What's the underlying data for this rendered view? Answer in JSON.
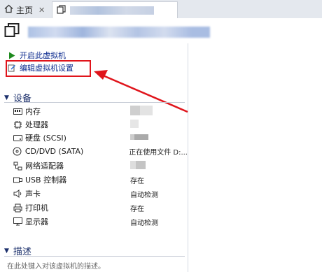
{
  "tabs": [
    {
      "label": "主页",
      "icon": "home-icon"
    },
    {
      "label": "",
      "icon": "vm-icon"
    }
  ],
  "actions": {
    "power_on": "开启此虚拟机",
    "edit_settings": "编辑虚拟机设置"
  },
  "devices_section": {
    "title": "设备",
    "rows": [
      {
        "icon": "memory-icon",
        "name": "内存",
        "value": ""
      },
      {
        "icon": "processor-icon",
        "name": "处理器",
        "value": ""
      },
      {
        "icon": "disk-icon",
        "name": "硬盘 (SCSI)",
        "value": ""
      },
      {
        "icon": "cd-dvd-icon",
        "name": "CD/DVD (SATA)",
        "value": "正在使用文件 D:..."
      },
      {
        "icon": "network-adapter-icon",
        "name": "网络适配器",
        "value": ""
      },
      {
        "icon": "usb-icon",
        "name": "USB 控制器",
        "value": "存在"
      },
      {
        "icon": "sound-card-icon",
        "name": "声卡",
        "value": "自动检测"
      },
      {
        "icon": "printer-icon",
        "name": "打印机",
        "value": "存在"
      },
      {
        "icon": "display-icon",
        "name": "显示器",
        "value": "自动检测"
      }
    ]
  },
  "description_section": {
    "title": "描述",
    "placeholder": "在此处键入对该虚拟机的描述。"
  },
  "annotation": {
    "highlight_color": "#e0141b"
  }
}
